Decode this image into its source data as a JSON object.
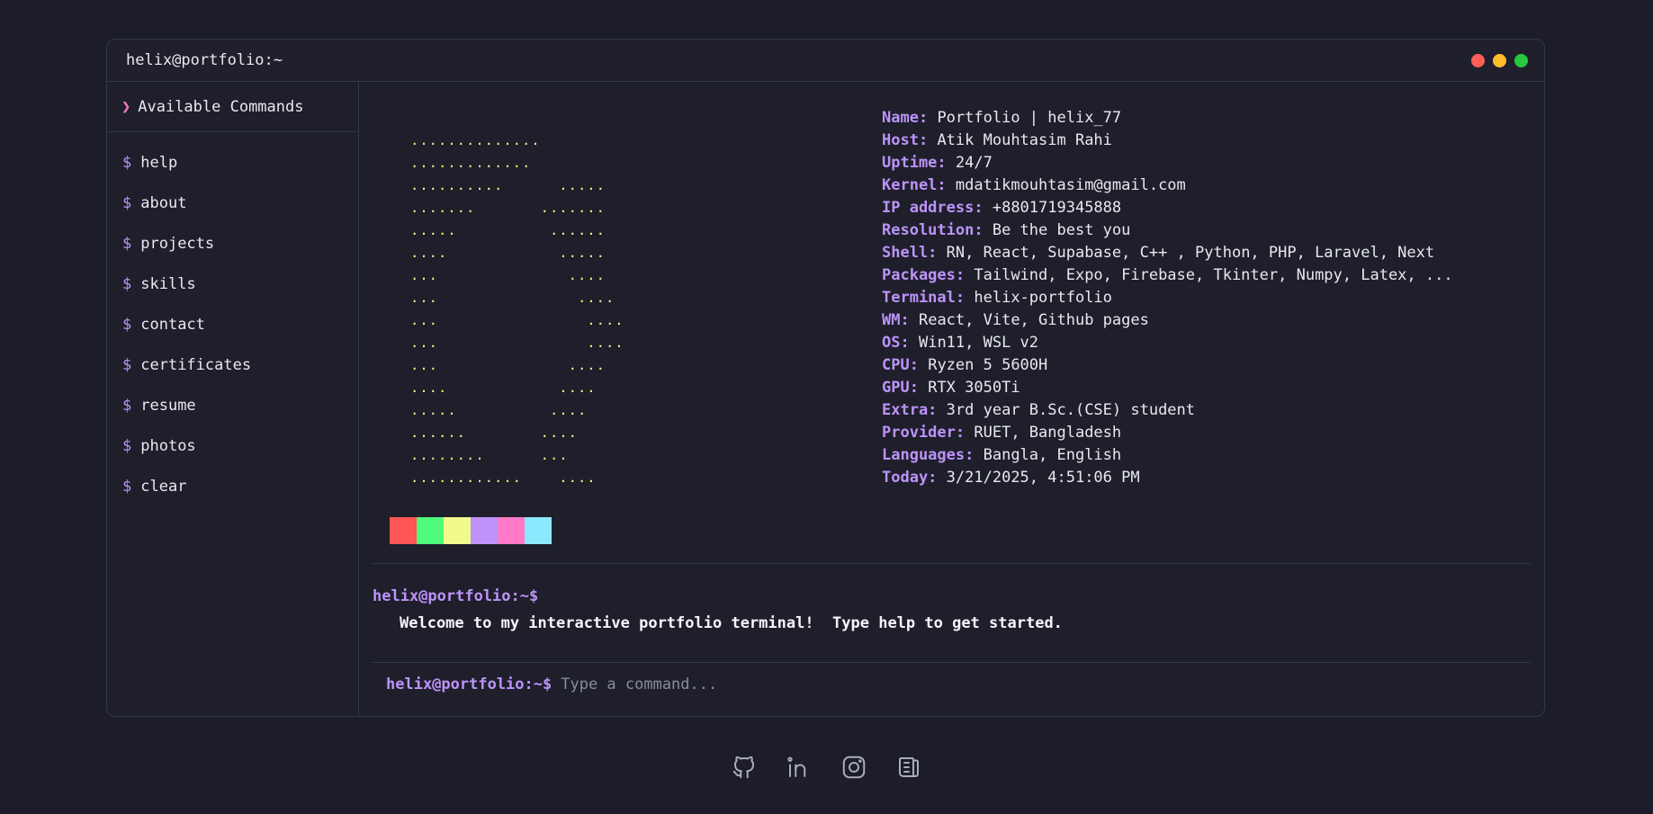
{
  "window": {
    "title": "helix@portfolio:~"
  },
  "sidebar": {
    "header": "Available Commands",
    "prompt_symbol": "$",
    "commands": [
      "help",
      "about",
      "projects",
      "skills",
      "contact",
      "certificates",
      "resume",
      "photos",
      "clear"
    ]
  },
  "ascii_art": [
    "..............",
    ".............",
    "..........      .....",
    ".......       .......",
    ".....          ......",
    "....            .....",
    "...              ....",
    "...               ....",
    "...                ....",
    "...                ....",
    "...              ....",
    "....            ....",
    ".....          ....",
    "......        ....",
    "........      ...",
    "............    ...."
  ],
  "info": [
    {
      "key": "Name:",
      "value": "Portfolio | helix_77"
    },
    {
      "key": "Host:",
      "value": "Atik Mouhtasim Rahi"
    },
    {
      "key": "Uptime:",
      "value": "24/7"
    },
    {
      "key": "Kernel:",
      "value": "mdatikmouhtasim@gmail.com"
    },
    {
      "key": "IP address:",
      "value": "+8801719345888"
    },
    {
      "key": "Resolution:",
      "value": "Be the best you"
    },
    {
      "key": "Shell:",
      "value": "RN, React, Supabase, C++ , Python, PHP, Laravel, Next"
    },
    {
      "key": "Packages:",
      "value": "Tailwind, Expo, Firebase, Tkinter, Numpy, Latex, ..."
    },
    {
      "key": "Terminal:",
      "value": "helix-portfolio"
    },
    {
      "key": "WM:",
      "value": "React, Vite, Github pages"
    },
    {
      "key": "OS:",
      "value": "Win11, WSL v2"
    },
    {
      "key": "CPU:",
      "value": "Ryzen 5 5600H"
    },
    {
      "key": "GPU:",
      "value": "RTX 3050Ti"
    },
    {
      "key": "Extra:",
      "value": "3rd year B.Sc.(CSE) student"
    },
    {
      "key": "Provider:",
      "value": "RUET, Bangladesh"
    },
    {
      "key": "Languages:",
      "value": "Bangla, English"
    },
    {
      "key": "Today:",
      "value": "3/21/2025, 4:51:06 PM"
    }
  ],
  "palette": [
    "#ff5555",
    "#50fa7b",
    "#f1fa8c",
    "#bd93f9",
    "#ff79c6",
    "#8be9fd"
  ],
  "terminal": {
    "prompt": "helix@portfolio:~$",
    "welcome": "Welcome to my interactive portfolio terminal!  Type help to get started.",
    "input_placeholder": "Type a command...",
    "input_value": ""
  },
  "social": [
    {
      "name": "github-icon"
    },
    {
      "name": "linkedin-icon"
    },
    {
      "name": "instagram-icon"
    },
    {
      "name": "blog-icon"
    }
  ]
}
